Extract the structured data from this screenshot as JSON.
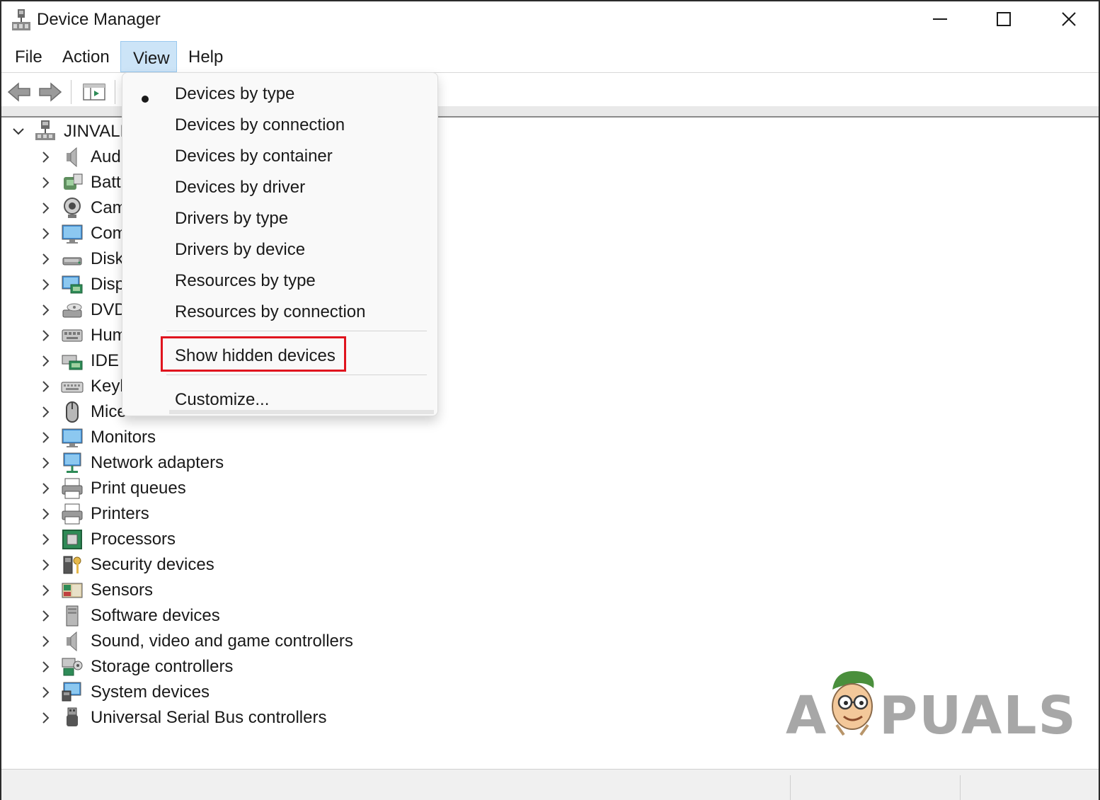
{
  "window": {
    "title": "Device Manager"
  },
  "menubar": {
    "items": [
      {
        "label": "File"
      },
      {
        "label": "Action"
      },
      {
        "label": "View"
      },
      {
        "label": "Help"
      }
    ]
  },
  "toolbar": {
    "buttons": [
      "back-arrow-icon",
      "forward-arrow-icon",
      "properties-pane-icon"
    ]
  },
  "tree": {
    "root": "JINVALD",
    "categories": [
      {
        "label": "Aud",
        "icon": "speaker-icon"
      },
      {
        "label": "Batt",
        "icon": "battery-icon"
      },
      {
        "label": "Cam",
        "icon": "camera-icon"
      },
      {
        "label": "Com",
        "icon": "computer-icon"
      },
      {
        "label": "Disk",
        "icon": "disk-drive-icon"
      },
      {
        "label": "Disp",
        "icon": "display-adapter-icon"
      },
      {
        "label": "DVD",
        "icon": "dvd-drive-icon"
      },
      {
        "label": "Hum",
        "icon": "hid-icon"
      },
      {
        "label": "IDE",
        "icon": "ide-controller-icon"
      },
      {
        "label": "Keyl",
        "icon": "keyboard-icon"
      },
      {
        "label": "Mice",
        "icon": "mouse-icon"
      },
      {
        "label": "Monitors",
        "icon": "monitor-icon"
      },
      {
        "label": "Network adapters",
        "icon": "network-adapter-icon"
      },
      {
        "label": "Print queues",
        "icon": "print-queue-icon"
      },
      {
        "label": "Printers",
        "icon": "printer-icon"
      },
      {
        "label": "Processors",
        "icon": "processor-icon"
      },
      {
        "label": "Security devices",
        "icon": "security-device-icon"
      },
      {
        "label": "Sensors",
        "icon": "sensor-icon"
      },
      {
        "label": "Software devices",
        "icon": "software-device-icon"
      },
      {
        "label": "Sound, video and game controllers",
        "icon": "speaker-icon"
      },
      {
        "label": "Storage controllers",
        "icon": "storage-controller-icon"
      },
      {
        "label": "System devices",
        "icon": "system-device-icon"
      },
      {
        "label": "Universal Serial Bus controllers",
        "icon": "usb-icon"
      }
    ]
  },
  "view_menu": {
    "items": [
      {
        "label": "Devices by type",
        "checked": true
      },
      {
        "label": "Devices by connection",
        "checked": false
      },
      {
        "label": "Devices by container",
        "checked": false
      },
      {
        "label": "Devices by driver",
        "checked": false
      },
      {
        "label": "Drivers by type",
        "checked": false
      },
      {
        "label": "Drivers by device",
        "checked": false
      },
      {
        "label": "Resources by type",
        "checked": false
      },
      {
        "label": "Resources by connection",
        "checked": false
      }
    ],
    "show_hidden": "Show hidden devices",
    "customize": "Customize..."
  },
  "colors": {
    "menu_highlight": "#cce4f7",
    "annotation_red": "#e0141e"
  },
  "watermark": {
    "text_a": "A",
    "text_rest": "PUALS"
  }
}
